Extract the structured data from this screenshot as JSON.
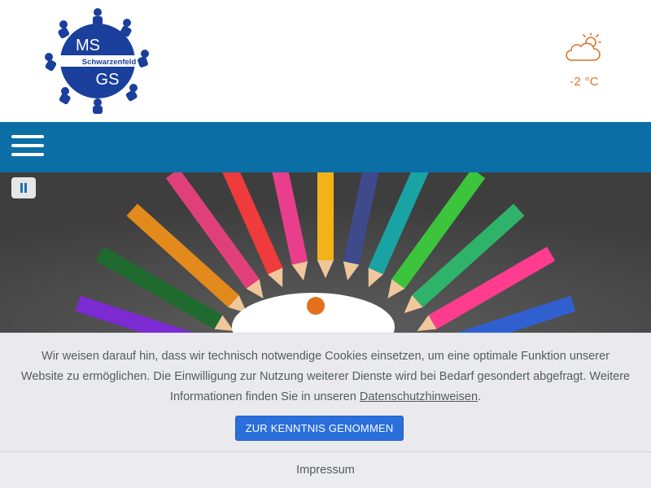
{
  "header": {
    "logo": {
      "line1": "MS",
      "line2": "GS",
      "band": "Schwarzenfeld",
      "icon": "school-logo"
    },
    "weather": {
      "icon": "partly-cloudy-icon",
      "temperature": "-2 °C"
    }
  },
  "navbar": {
    "menu_icon": "hamburger-menu-icon",
    "color": "#0b6fa6"
  },
  "hero": {
    "pause_icon": "pause-icon",
    "image": "colored-pencils-circle"
  },
  "cookie_banner": {
    "text_before_link": "Wir weisen darauf hin, dass wir technisch notwendige Cookies einsetzen, um eine optimale Funktion unserer Website zu ermöglichen. Die Einwilligung zur Nutzung weiterer Dienste wird bei Bedarf gesondert abgefragt. Weitere Informationen finden Sie in unseren ",
    "link_label": "Datenschutzhinweisen",
    "text_after_link": ".",
    "button_label": "ZUR KENNTNIS GENOMMEN"
  },
  "footer": {
    "impressum_label": "Impressum"
  },
  "colors": {
    "accent": "#0b6fa6",
    "button": "#2a6fdb",
    "weather": "#d9772b",
    "logo": "#1a3f9c"
  }
}
